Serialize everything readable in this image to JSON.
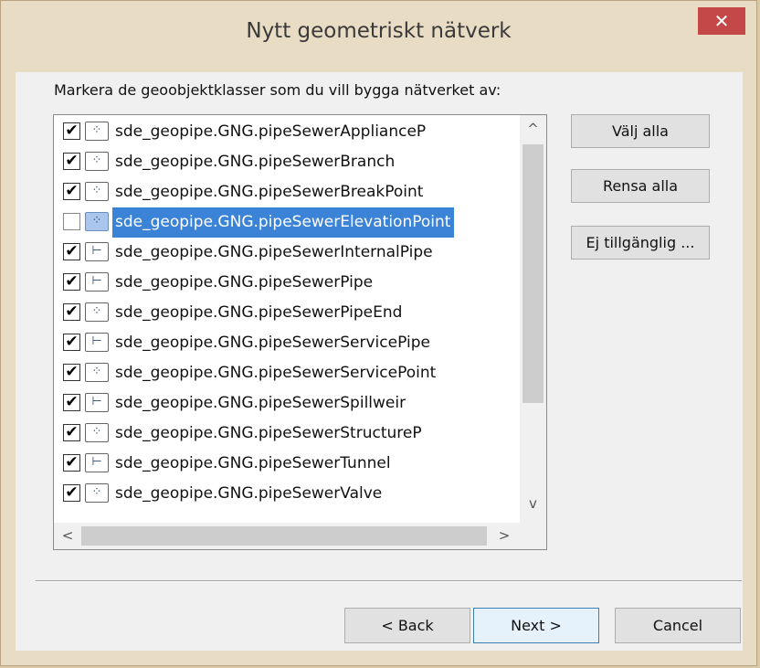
{
  "window": {
    "title": "Nytt geometriskt nätverk",
    "close_glyph": "✕"
  },
  "prompt": "Markera de geoobjektklasser som du vill bygga nätverket av:",
  "list": {
    "items": [
      {
        "label": "sde_geopipe.GNG.pipeSewerApplianceP",
        "checked": true,
        "icon": "point-feature-icon",
        "selected": false
      },
      {
        "label": "sde_geopipe.GNG.pipeSewerBranch",
        "checked": true,
        "icon": "point-feature-icon",
        "selected": false
      },
      {
        "label": "sde_geopipe.GNG.pipeSewerBreakPoint",
        "checked": true,
        "icon": "point-feature-icon",
        "selected": false
      },
      {
        "label": "sde_geopipe.GNG.pipeSewerElevationPoint",
        "checked": false,
        "icon": "point-feature-icon",
        "selected": true
      },
      {
        "label": "sde_geopipe.GNG.pipeSewerInternalPipe",
        "checked": true,
        "icon": "line-feature-icon",
        "selected": false
      },
      {
        "label": "sde_geopipe.GNG.pipeSewerPipe",
        "checked": true,
        "icon": "line-feature-icon",
        "selected": false
      },
      {
        "label": "sde_geopipe.GNG.pipeSewerPipeEnd",
        "checked": true,
        "icon": "point-feature-icon",
        "selected": false
      },
      {
        "label": "sde_geopipe.GNG.pipeSewerServicePipe",
        "checked": true,
        "icon": "line-feature-icon",
        "selected": false
      },
      {
        "label": "sde_geopipe.GNG.pipeSewerServicePoint",
        "checked": true,
        "icon": "point-feature-icon",
        "selected": false
      },
      {
        "label": "sde_geopipe.GNG.pipeSewerSpillweir",
        "checked": true,
        "icon": "line-feature-icon",
        "selected": false
      },
      {
        "label": "sde_geopipe.GNG.pipeSewerStructureP",
        "checked": true,
        "icon": "point-feature-icon",
        "selected": false
      },
      {
        "label": "sde_geopipe.GNG.pipeSewerTunnel",
        "checked": true,
        "icon": "line-feature-icon",
        "selected": false
      },
      {
        "label": "sde_geopipe.GNG.pipeSewerValve",
        "checked": true,
        "icon": "point-feature-icon",
        "selected": false
      }
    ]
  },
  "side_buttons": {
    "select_all": "Välj alla",
    "clear_all": "Rensa alla",
    "not_available": "Ej tillgänglig ..."
  },
  "footer": {
    "back": "< Back",
    "next": "Next >",
    "cancel": "Cancel"
  },
  "icons": {
    "checkmark": "✔",
    "point_glyph": "⁘",
    "line_glyph": "⊢",
    "scroll_up": "^",
    "scroll_down": "v",
    "scroll_left": "<",
    "scroll_right": ">"
  },
  "colors": {
    "selection": "#3b83d6",
    "close": "#c54848",
    "default_button_border": "#3c7fb1"
  }
}
